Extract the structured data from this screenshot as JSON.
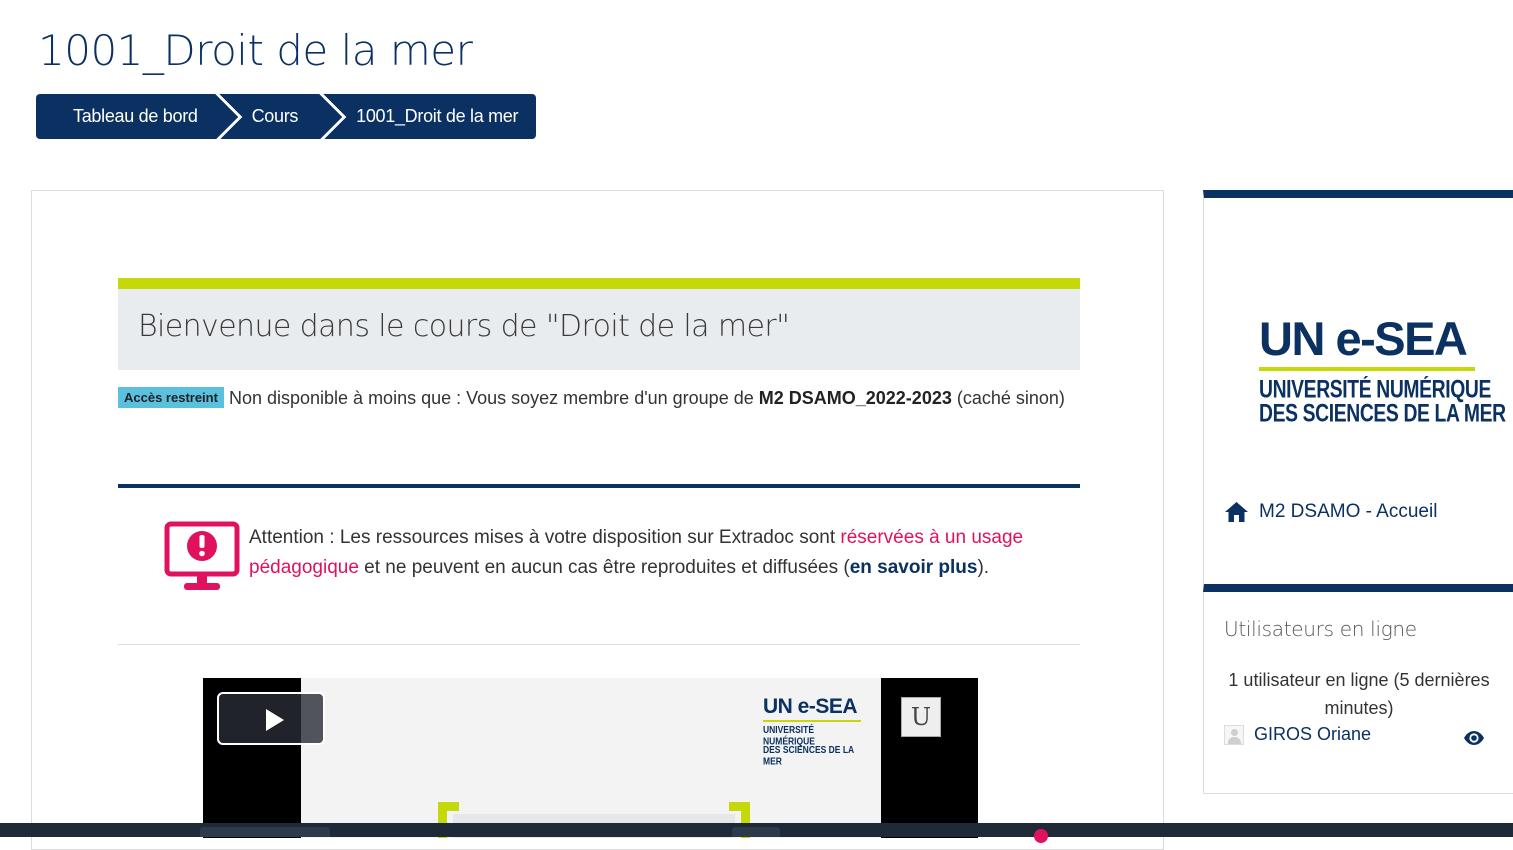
{
  "page": {
    "title": "1001_Droit de la mer"
  },
  "breadcrumb": {
    "items": [
      {
        "label": "Tableau de bord"
      },
      {
        "label": "Cours"
      },
      {
        "label": "1001_Droit de la mer"
      }
    ]
  },
  "course": {
    "welcome_title": "Bienvenue dans le cours de \"Droit de la mer\"",
    "restriction": {
      "badge": "Accès restreint",
      "text_before": "Non disponible à moins que : Vous soyez membre d'un groupe de",
      "group": "M2 DSAMO_2022-2023",
      "text_after": "(caché sinon)"
    },
    "attention": {
      "text_1": "Attention : Les ressources mises à votre disposition sur Extradoc sont",
      "highlight": "réservées à un usage pédagogique",
      "text_2": "et ne peuvent en aucun cas être reproduites et diffusées (",
      "learn_more": "en savoir plus",
      "text_3": ")."
    },
    "video": {
      "logo_big": "UN e-SEA",
      "logo_line1": "UNIVERSITÉ NUMÉRIQUE",
      "logo_line2": "DES SCIENCES DE LA MER",
      "corner_mark": "U"
    }
  },
  "sidebar": {
    "logo": {
      "big": "UN e-SEA",
      "line1": "UNIVERSITÉ NUMÉRIQUE",
      "line2": "DES SCIENCES DE LA MER"
    },
    "home_link": "M2 DSAMO - Accueil",
    "online_users": {
      "title": "Utilisateurs en ligne",
      "count_text": "1 utilisateur en ligne (5 dernières minutes)",
      "users": [
        {
          "name": "GIROS Oriane"
        }
      ]
    }
  },
  "colors": {
    "navy": "#0a3161",
    "lime": "#c5d80a",
    "pink": "#e0115f",
    "badge": "#5bc0de"
  },
  "icons": [
    "home-icon",
    "eye-icon",
    "alert-monitor-icon",
    "play-icon",
    "avatar-placeholder-icon"
  ]
}
